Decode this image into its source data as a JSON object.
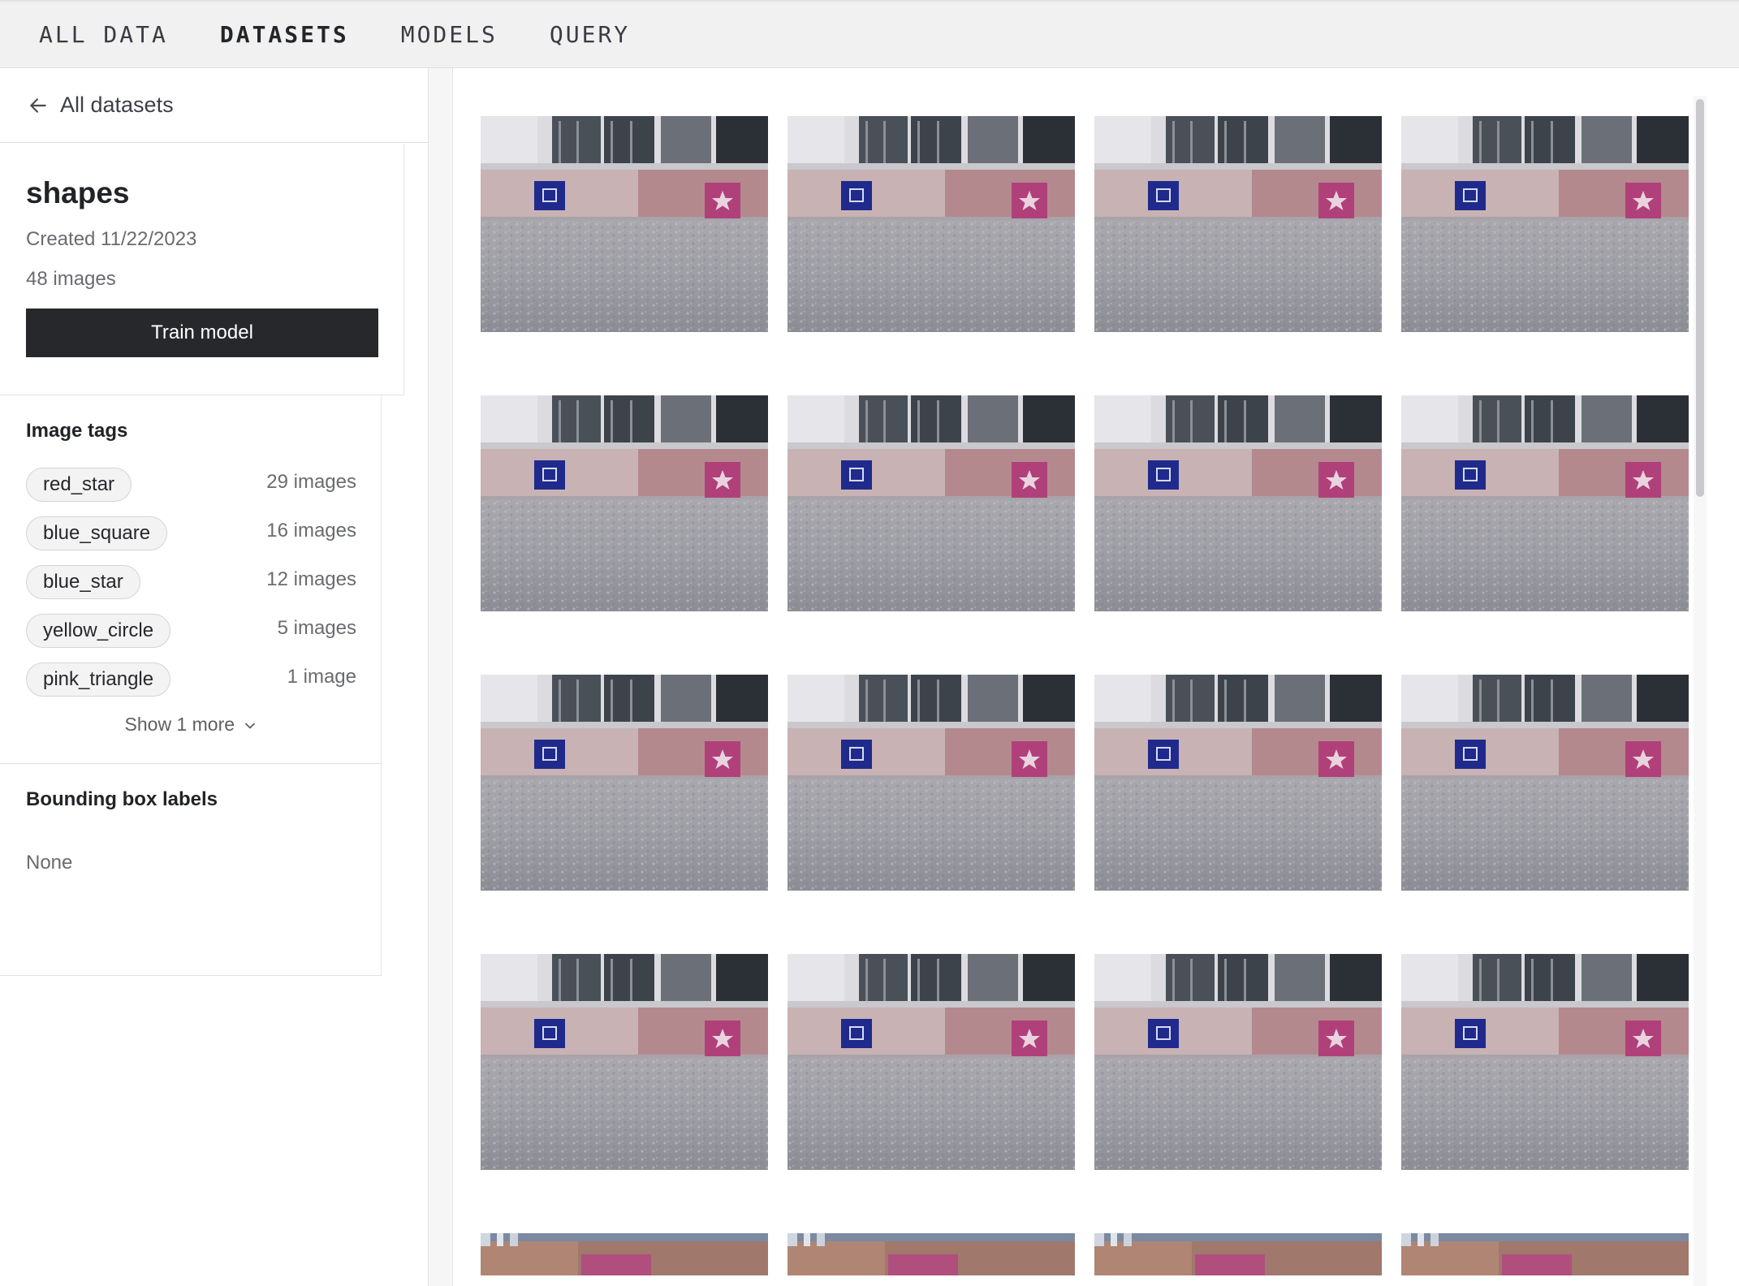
{
  "nav": {
    "tabs": [
      {
        "label": "ALL DATA",
        "active": false
      },
      {
        "label": "DATASETS",
        "active": true
      },
      {
        "label": "MODELS",
        "active": false
      },
      {
        "label": "QUERY",
        "active": false
      }
    ]
  },
  "sidebar": {
    "back_label": "All datasets",
    "dataset": {
      "name": "shapes",
      "created": "Created 11/22/2023",
      "image_count": "48 images",
      "train_button": "Train model"
    },
    "image_tags": {
      "title": "Image tags",
      "items": [
        {
          "tag": "red_star",
          "count": "29 images"
        },
        {
          "tag": "blue_square",
          "count": "16 images"
        },
        {
          "tag": "blue_star",
          "count": "12 images"
        },
        {
          "tag": "yellow_circle",
          "count": "5 images"
        },
        {
          "tag": "pink_triangle",
          "count": "1 image"
        }
      ],
      "show_more": "Show 1 more"
    },
    "bounding_box_labels": {
      "title": "Bounding box labels",
      "value": "None"
    }
  },
  "gallery": {
    "columns": 4,
    "full_rows": 4,
    "partial_row_visible": true
  },
  "colors": {
    "nav_bg": "#f1f1f2",
    "button_bg": "#27282c",
    "chip_bg": "#f3f3f4",
    "square_blue": "#1f2a8c",
    "star_pink": "#b0407a"
  }
}
